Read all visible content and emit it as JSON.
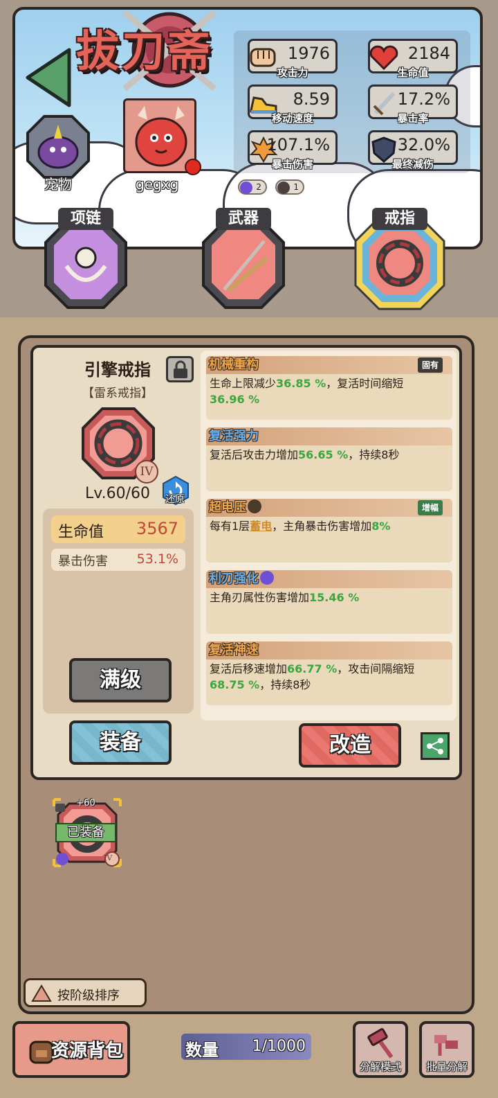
{
  "header": {
    "title": "拔刀斋",
    "back_icon": "back-arrow-icon"
  },
  "stats": [
    {
      "icon": "fist-icon",
      "value": "1976",
      "label": "攻击力"
    },
    {
      "icon": "heart-icon",
      "value": "2184",
      "label": "生命值"
    },
    {
      "icon": "sneaker-icon",
      "value": "8.59",
      "label": "移动速度"
    },
    {
      "icon": "sword-icon",
      "value": "17.2%",
      "label": "暴击率"
    },
    {
      "icon": "explosion-icon",
      "value": "107.1%",
      "label": "暴击伤害"
    },
    {
      "icon": "shield-icon",
      "value": "32.0%",
      "label": "最终减伤"
    }
  ],
  "resonance": [
    {
      "icon": "vortex-icon",
      "count": "2",
      "color": "#6e4fd6"
    },
    {
      "icon": "lightning-icon",
      "count": "1",
      "color": "#4a4040"
    }
  ],
  "pet": {
    "label": "宠物"
  },
  "player": {
    "name": "gegxg"
  },
  "slots": [
    {
      "label": "项链",
      "icon": "skull-necklace-icon",
      "selected": false
    },
    {
      "label": "武器",
      "icon": "katana-icon",
      "selected": false
    },
    {
      "label": "戒指",
      "icon": "mechanical-ring-icon",
      "selected": true
    }
  ],
  "item": {
    "name": "引擎戒指",
    "type": "【雷系戒指】",
    "tier": "IV",
    "level": "Lv.60/60",
    "restore_label": "还原",
    "main_stat": {
      "label": "生命值",
      "value": "3567"
    },
    "sub_stat": {
      "label": "暴击伤害",
      "value": "53.1%"
    }
  },
  "affixes": [
    {
      "title": "机械重构",
      "tag": "固有",
      "parts": [
        "生命上限减少",
        "36.85 %",
        "，复活时间缩短",
        "36.96 %"
      ]
    },
    {
      "title": "复活强力",
      "tag": "",
      "parts": [
        "复活后攻击力增加",
        "56.65 %",
        "，持续8秒"
      ]
    },
    {
      "title": "超电压",
      "tag": "增幅",
      "parts": [
        "每有1层",
        "蓄电",
        "，主角暴击伤害增加",
        "8%"
      ]
    },
    {
      "title": "利刃强化",
      "tag": "",
      "parts": [
        "主角刃属性伤害增加",
        "15.46 %"
      ]
    },
    {
      "title": "复活神速",
      "tag": "",
      "parts": [
        "复活后移速增加",
        "66.77 %",
        "，攻击间隔缩短",
        "68.75 %",
        "，持续8秒"
      ]
    }
  ],
  "buttons": {
    "max_level": "满级",
    "equip": "装备",
    "reforge": "改造"
  },
  "inventory": [
    {
      "plus": "+60",
      "status": "已装备",
      "tier": "IV"
    }
  ],
  "sort": {
    "label": "按阶级排序"
  },
  "bottom": {
    "backpack": "资源背包",
    "count_label": "数量",
    "count_value": "1/1000",
    "decompose_mode": "分解模式",
    "batch_decompose": "批量分解"
  },
  "colors": {
    "accent_red": "#c0463a",
    "value_green": "#3aa640",
    "panel_brown": "#a88d78"
  }
}
